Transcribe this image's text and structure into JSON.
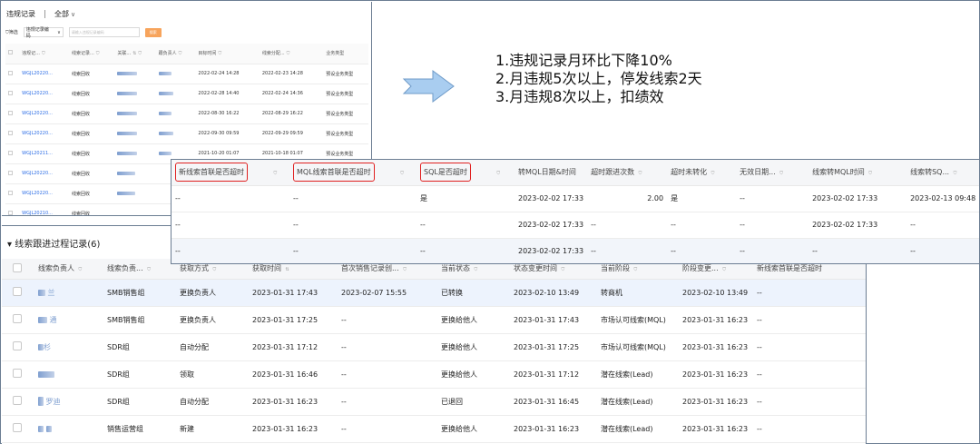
{
  "violation_panel": {
    "tabs": [
      "违规记录",
      "全部"
    ],
    "filter_label": "筛选",
    "filter_field": "违规记录编码",
    "search_placeholder": "请输入违规记录编码",
    "search_button": "搜索",
    "columns": [
      "违规记...",
      "线索记录...",
      "关联...",
      "跟负责人",
      "目标时间",
      "线索分配...",
      "业务类型"
    ],
    "rows": [
      {
        "code": "WGJL20220...",
        "type": "线索回收",
        "time1": "2022-02-24 14:28",
        "time2": "2022-02-23 14:28",
        "biz": "预设业务类型"
      },
      {
        "code": "WGJL20220...",
        "type": "线索回收",
        "time1": "2022-02-28 14:40",
        "time2": "2022-02-24 14:36",
        "biz": "预设业务类型"
      },
      {
        "code": "WGJL20220...",
        "type": "线索回收",
        "time1": "2022-08-30 16:22",
        "time2": "2022-08-29 16:22",
        "biz": "预设业务类型"
      },
      {
        "code": "WGJL20220...",
        "type": "线索回收",
        "time1": "2022-09-30 09:59",
        "time2": "2022-09-29 09:59",
        "biz": "预设业务类型"
      },
      {
        "code": "WGJL20211...",
        "type": "线索回收",
        "time1": "2021-10-20 01:07",
        "time2": "2021-10-18 01:07",
        "biz": "预设业务类型"
      },
      {
        "code": "WGJL20220...",
        "type": "线索回收"
      },
      {
        "code": "WGJL20220...",
        "type": "线索回收"
      },
      {
        "code": "WGJL20210...",
        "type": "线索回收"
      }
    ]
  },
  "notes": [
    "1.违规记录月环比下降10%",
    "2.月违规5次以上，停发线索2天",
    "3.月违规8次以上，扣绩效"
  ],
  "followup_panel": {
    "title": "线索跟进过程记录(6)",
    "columns": [
      "线索负责人",
      "线索负责...",
      "获取方式",
      "获取时间",
      "首次销售记录创...",
      "当前状态",
      "状态变更时间",
      "当前阶段",
      "阶段变更...",
      "新线索首联是否超时"
    ],
    "rows": [
      {
        "owner": "兰",
        "group": "SMB销售组",
        "method": "更换负责人",
        "time": "2023-01-31 17:43",
        "first": "2023-02-07 15:55",
        "status": "已转换",
        "status_time": "2023-02-10 13:49",
        "stage": "转商机",
        "stage_time": "2023-02-10 13:49",
        "timeout": "--"
      },
      {
        "owner": "通",
        "group": "SMB销售组",
        "method": "更换负责人",
        "time": "2023-01-31 17:25",
        "first": "--",
        "status": "更换给他人",
        "status_time": "2023-01-31 17:43",
        "stage": "市场认可线索(MQL)",
        "stage_time": "2023-01-31 16:23",
        "timeout": "--"
      },
      {
        "owner": "杉",
        "group": "SDR组",
        "method": "自动分配",
        "time": "2023-01-31 17:12",
        "first": "--",
        "status": "更换给他人",
        "status_time": "2023-01-31 17:25",
        "stage": "市场认可线索(MQL)",
        "stage_time": "2023-01-31 16:23",
        "timeout": "--"
      },
      {
        "owner": "",
        "group": "SDR组",
        "method": "领取",
        "time": "2023-01-31 16:46",
        "first": "--",
        "status": "更换给他人",
        "status_time": "2023-01-31 17:12",
        "stage": "潜在线索(Lead)",
        "stage_time": "2023-01-31 16:23",
        "timeout": "--"
      },
      {
        "owner": "罗迪",
        "group": "SDR组",
        "method": "自动分配",
        "time": "2023-01-31 16:23",
        "first": "--",
        "status": "已退回",
        "status_time": "2023-01-31 16:45",
        "stage": "潜在线索(Lead)",
        "stage_time": "2023-01-31 16:23",
        "timeout": "--"
      },
      {
        "owner": "",
        "group": "销售运营组",
        "method": "新建",
        "time": "2023-01-31 16:23",
        "first": "--",
        "status": "更换给他人",
        "status_time": "2023-01-31 16:23",
        "stage": "潜在线索(Lead)",
        "stage_time": "2023-01-31 16:23",
        "timeout": "--"
      }
    ]
  },
  "overlay_panel": {
    "columns": [
      "新线索首联是否超时",
      "MQL线索首联是否超时",
      "SQL是否超时",
      "转MQL日期&时间",
      "超时跟进次数",
      "超时未转化",
      "无效日期...",
      "线索转MQL时间",
      "线索转SQ..."
    ],
    "rows": [
      {
        "c1": "--",
        "c2": "--",
        "c3": "是",
        "c4": "2023-02-02 17:33",
        "c5": "2.00",
        "c6": "是",
        "c7": "--",
        "c8": "2023-02-02 17:33",
        "c9": "2023-02-13 09:48"
      },
      {
        "c1": "--",
        "c2": "--",
        "c3": "--",
        "c4": "2023-02-02 17:33",
        "c5": "--",
        "c6": "--",
        "c7": "--",
        "c8": "2023-02-02 17:33",
        "c9": "--"
      },
      {
        "c1": "--",
        "c2": "--",
        "c3": "--",
        "c4": "2023-02-02 17:33",
        "c5": "--",
        "c6": "--",
        "c7": "--",
        "c8": "--",
        "c9": "--"
      }
    ]
  },
  "colors": {
    "link": "#2f6fe6",
    "highlight_box": "#e02020",
    "search_button": "#f7a45c",
    "arrow": "#a9cdf0"
  }
}
